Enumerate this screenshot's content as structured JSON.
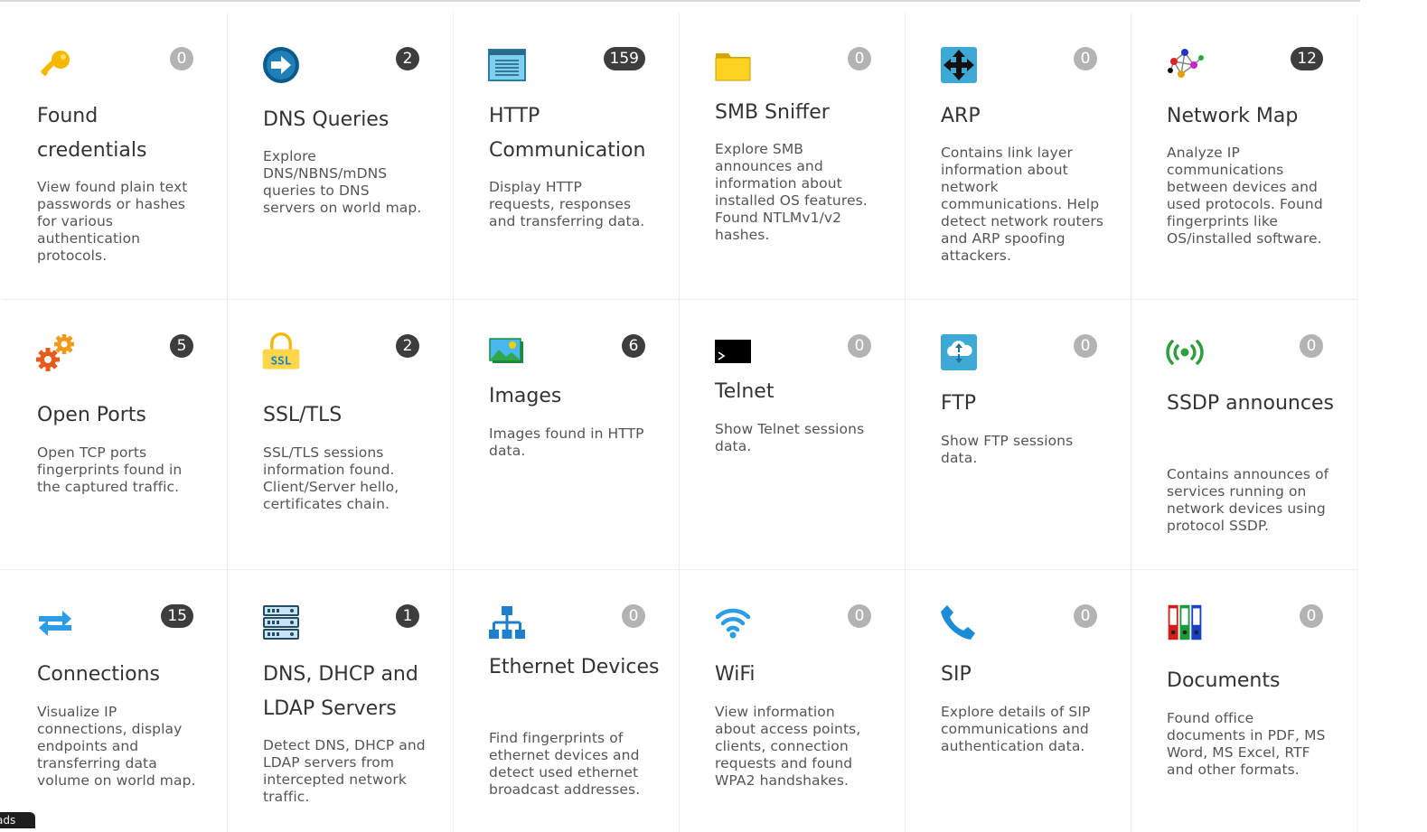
{
  "tiles": [
    {
      "icon": "key-icon",
      "title": "Found credentials",
      "count": "0",
      "desc": "View found plain text passwords or hashes for various authentication protocols.",
      "titleTop": 96,
      "descTop": 184
    },
    {
      "icon": "arrow-circle-icon",
      "title": "DNS Queries",
      "count": "2",
      "desc": "Explore DNS/NBNS/mDNS queries to DNS servers on world map.",
      "titleTop": 100,
      "descTop": 150
    },
    {
      "icon": "browser-window-icon",
      "title": "HTTP Communication",
      "count": "159",
      "desc": "Display HTTP requests, responses and transferring data.",
      "titleTop": 96,
      "descTop": 184
    },
    {
      "icon": "folder-icon",
      "title": "SMB Sniffer",
      "count": "0",
      "desc": "Explore SMB announces and information about installed OS features. Found NTLMv1/v2 hashes.",
      "titleTop": 92,
      "descTop": 142
    },
    {
      "icon": "move-arrows-icon",
      "title": "ARP",
      "count": "0",
      "desc": "Contains link layer information about network communications. Help detect network routers and ARP spoofing attackers.",
      "titleTop": 96,
      "descTop": 146
    },
    {
      "icon": "network-graph-icon",
      "title": "Network Map",
      "count": "12",
      "desc": "Analyze IP communications between devices and used protocols. Found fingerprints like OS/installed software.",
      "titleTop": 96,
      "descTop": 146
    },
    {
      "icon": "gears-icon",
      "title": "Open Ports",
      "count": "5",
      "desc": "Open TCP ports fingerprints found in the captured traffic.",
      "titleTop": 109,
      "descTop": 160
    },
    {
      "icon": "ssl-lock-icon",
      "title": "SSL/TLS",
      "count": "2",
      "desc": "SSL/TLS sessions information found. Client/Server hello, certificates chain.",
      "titleTop": 109,
      "descTop": 160
    },
    {
      "icon": "image-icon",
      "title": "Images",
      "count": "6",
      "desc": "Images found in HTTP data.",
      "titleTop": 88,
      "descTop": 139
    },
    {
      "icon": "terminal-icon",
      "title": "Telnet",
      "count": "0",
      "desc": "Show Telnet sessions data.",
      "titleTop": 83,
      "descTop": 134
    },
    {
      "icon": "cloud-transfer-icon",
      "title": "FTP",
      "count": "0",
      "desc": "Show FTP sessions data.",
      "titleTop": 96,
      "descTop": 147
    },
    {
      "icon": "broadcast-icon",
      "title": "SSDP announces",
      "count": "0",
      "desc": "Contains announces of services running on network devices using protocol SSDP.",
      "titleTop": 96,
      "descTop": 184
    },
    {
      "icon": "swap-arrows-icon",
      "title": "Connections",
      "count": "15",
      "desc": "Visualize IP connections, display endpoints and transferring data volume on world map.",
      "titleTop": 97,
      "descTop": 148
    },
    {
      "icon": "server-rack-icon",
      "title": "DNS, DHCP and LDAP Servers",
      "count": "1",
      "desc": "Detect DNS, DHCP and LDAP servers from intercepted network traffic.",
      "titleTop": 97,
      "descTop": 185
    },
    {
      "icon": "ethernet-topology-icon",
      "title": "Ethernet Devices",
      "count": "0",
      "desc": "Find fingerprints of ethernet devices and detect used ethernet broadcast addresses.",
      "titleTop": 89,
      "descTop": 177
    },
    {
      "icon": "wifi-icon",
      "title": "WiFi",
      "count": "0",
      "desc": "View information about access points, clients, connection requests and found WPA2 handshakes.",
      "titleTop": 97,
      "descTop": 148
    },
    {
      "icon": "phone-icon",
      "title": "SIP",
      "count": "0",
      "desc": "Explore details of SIP communications and authentication data.",
      "titleTop": 97,
      "descTop": 148
    },
    {
      "icon": "binders-icon",
      "title": "Documents",
      "count": "0",
      "desc": "Found office documents in PDF, MS Word, MS Excel, RTF and other formats.",
      "titleTop": 104,
      "descTop": 155
    }
  ],
  "corner_label": "ads"
}
